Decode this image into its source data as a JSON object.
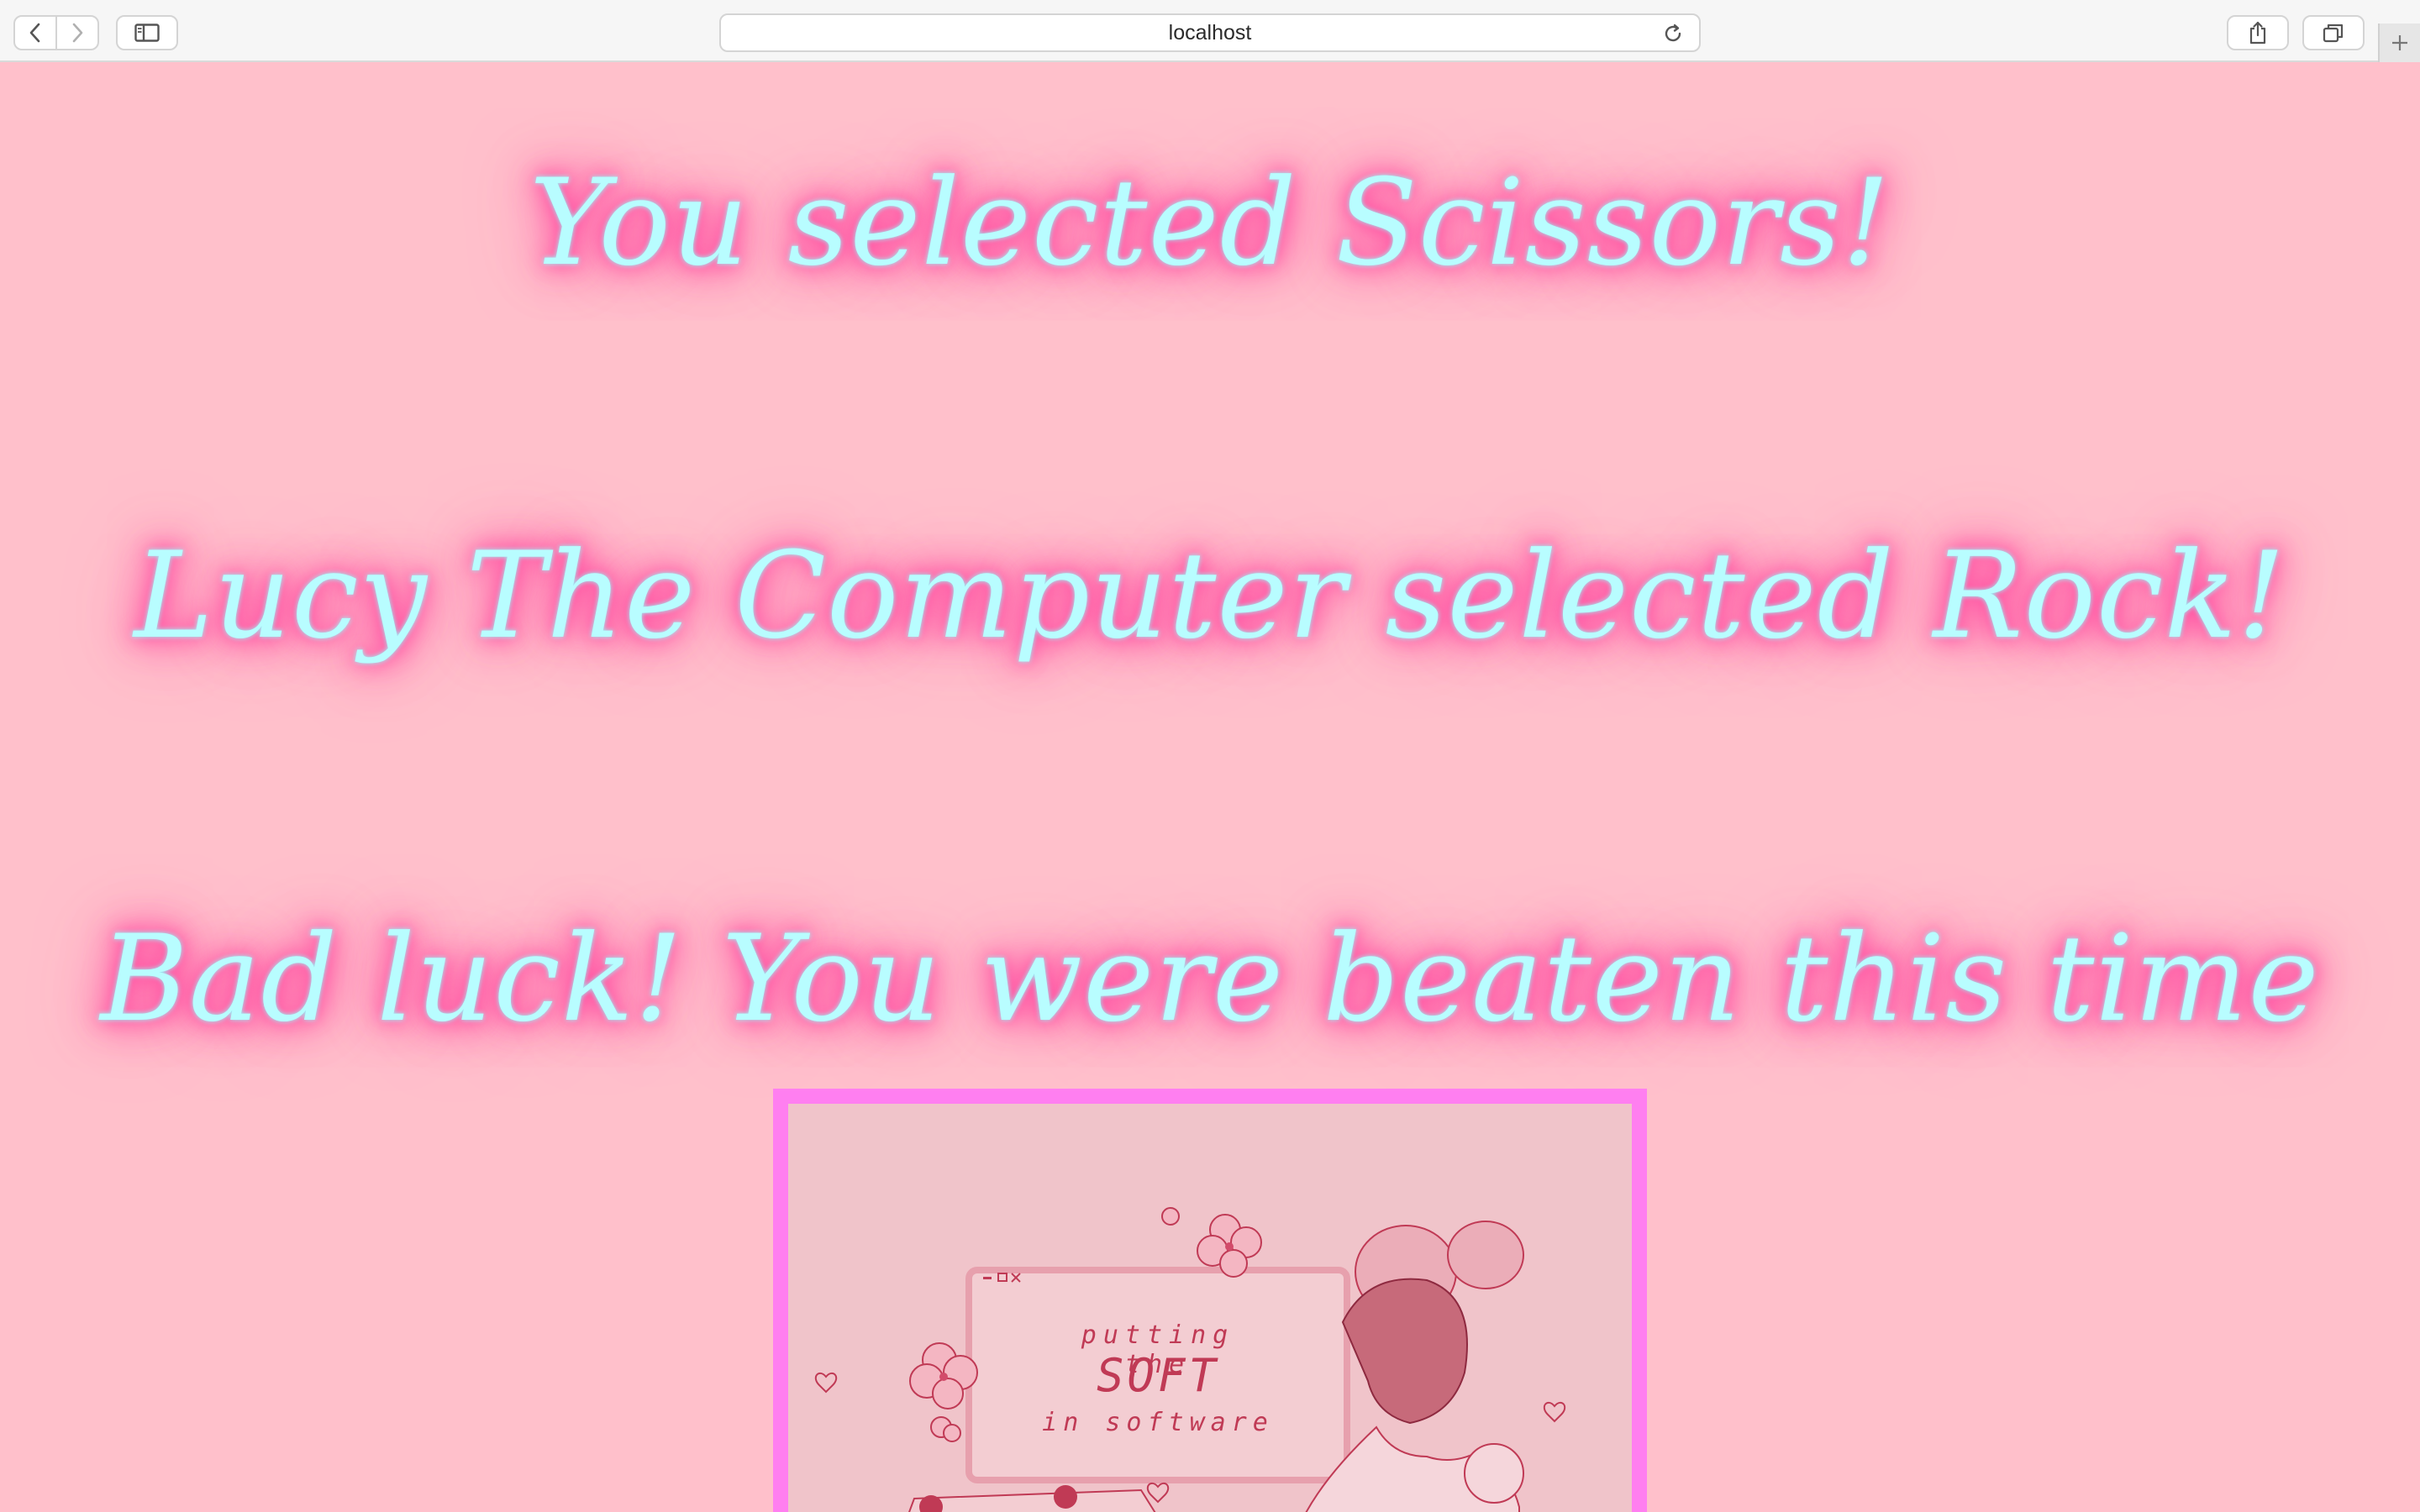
{
  "browser": {
    "url": "localhost",
    "icons": {
      "back": "chevron-left-icon",
      "forward": "chevron-right-icon",
      "sidebar": "sidebar-icon",
      "reload": "reload-icon",
      "share": "share-icon",
      "tabs": "tabs-icon",
      "new_tab": "plus-icon"
    }
  },
  "game": {
    "player_choice_text": "You selected Scissors!",
    "computer_choice_text": "Lucy The Computer selected Rock!",
    "result_text": "Bad luck! You were beaten this time"
  },
  "image": {
    "line1": "putting the",
    "line2": "SOFT",
    "line3": "in software"
  },
  "colors": {
    "page_background": "#ffc0cb",
    "text_color": "#b8fdff",
    "glow_color": "#ff4fa3",
    "frame_border": "#ff7ff0"
  }
}
